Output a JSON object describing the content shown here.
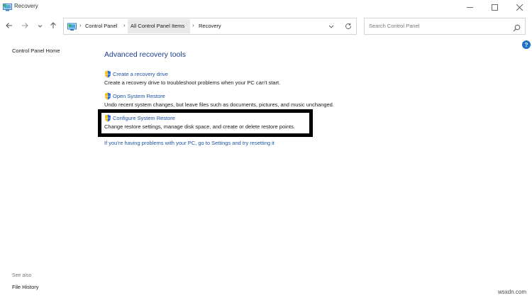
{
  "window": {
    "title": "Recovery",
    "minimize_icon": "minimize-icon",
    "maximize_icon": "maximize-icon",
    "close_icon": "close-icon"
  },
  "nav": {
    "breadcrumbs": [
      "Control Panel",
      "All Control Panel Items",
      "Recovery"
    ],
    "search_placeholder": "Search Control Panel"
  },
  "left_pane": {
    "home_link": "Control Panel Home",
    "see_also_label": "See also",
    "see_also_links": [
      "File History"
    ]
  },
  "main": {
    "heading": "Advanced recovery tools",
    "tasks": [
      {
        "label": "Create a recovery drive",
        "description": "Create a recovery drive to troubleshoot problems when your PC can't start."
      },
      {
        "label": "Open System Restore",
        "description": "Undo recent system changes, but leave files such as documents, pictures, and music unchanged."
      },
      {
        "label": "Configure System Restore",
        "description": "Change restore settings, manage disk space, and create or delete restore points."
      }
    ],
    "reset_link": "If you're having problems with your PC, go to Settings and try resetting it"
  },
  "watermark": "wsxdn.com",
  "colors": {
    "link": "#1c55a5",
    "heading": "#1c3f8e",
    "highlight_border": "#000000",
    "help_badge": "#1e73c8"
  }
}
